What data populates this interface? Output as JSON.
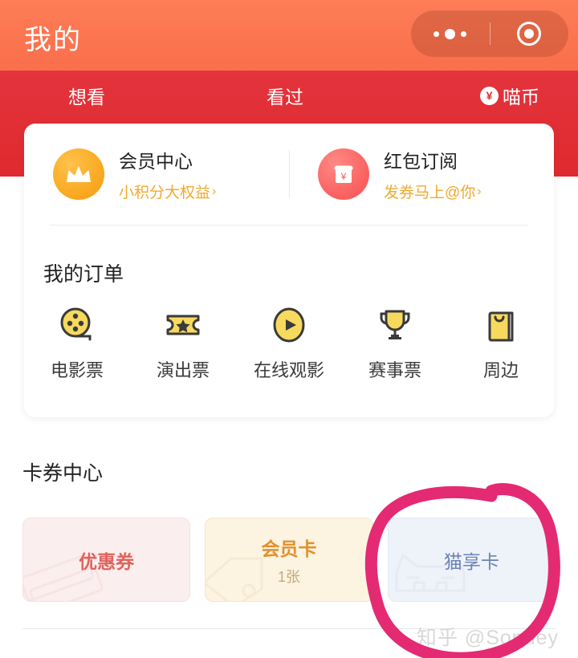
{
  "header": {
    "title": "我的",
    "capsule": {
      "more_icon": "more-dots-icon",
      "target_icon": "target-circle-icon"
    },
    "colors": {
      "orange": "#fb6f4c",
      "red": "#e02a2f"
    }
  },
  "tabs": [
    {
      "label": "想看",
      "name": "tab-want-to-watch"
    },
    {
      "label": "看过",
      "name": "tab-watched"
    },
    {
      "label": "喵币",
      "name": "tab-meow-coin",
      "badge": "¥"
    }
  ],
  "entries": [
    {
      "title": "会员中心",
      "subtitle": "小积分大权益",
      "chevron": "›",
      "icon": "crown-icon",
      "icon_color": "#f9a61e"
    },
    {
      "title": "红包订阅",
      "subtitle": "发券马上@你",
      "chevron": "›",
      "icon": "red-packet-icon",
      "icon_color": "#fa5f5f"
    }
  ],
  "orders": {
    "section_title": "我的订单",
    "items": [
      {
        "label": "电影票",
        "icon": "film-reel-icon"
      },
      {
        "label": "演出票",
        "icon": "star-ticket-icon"
      },
      {
        "label": "在线观影",
        "icon": "play-circle-icon"
      },
      {
        "label": "赛事票",
        "icon": "trophy-icon"
      },
      {
        "label": "周边",
        "icon": "shopping-bag-icon"
      }
    ]
  },
  "coupon_center": {
    "section_title": "卡券中心",
    "cards": [
      {
        "label": "优惠券",
        "count": "",
        "name": "card-coupon",
        "color": "#e0625c",
        "bg": "#fbeeee",
        "watermark": "coupon-ticket-watermark"
      },
      {
        "label": "会员卡",
        "count": "1张",
        "name": "card-membership",
        "color": "#e2902c",
        "bg": "#fcf3e1",
        "watermark": "price-tag-watermark"
      },
      {
        "label": "猫享卡",
        "count": "",
        "name": "card-cat-pass",
        "color": "#6b83b5",
        "bg": "#eef2f9",
        "watermark": "cat-face-watermark"
      }
    ]
  },
  "annotation": {
    "shape": "hand-drawn-circle",
    "color": "#e42a72",
    "target": "猫享卡"
  },
  "watermark": {
    "text": "知乎 @Sonney"
  }
}
